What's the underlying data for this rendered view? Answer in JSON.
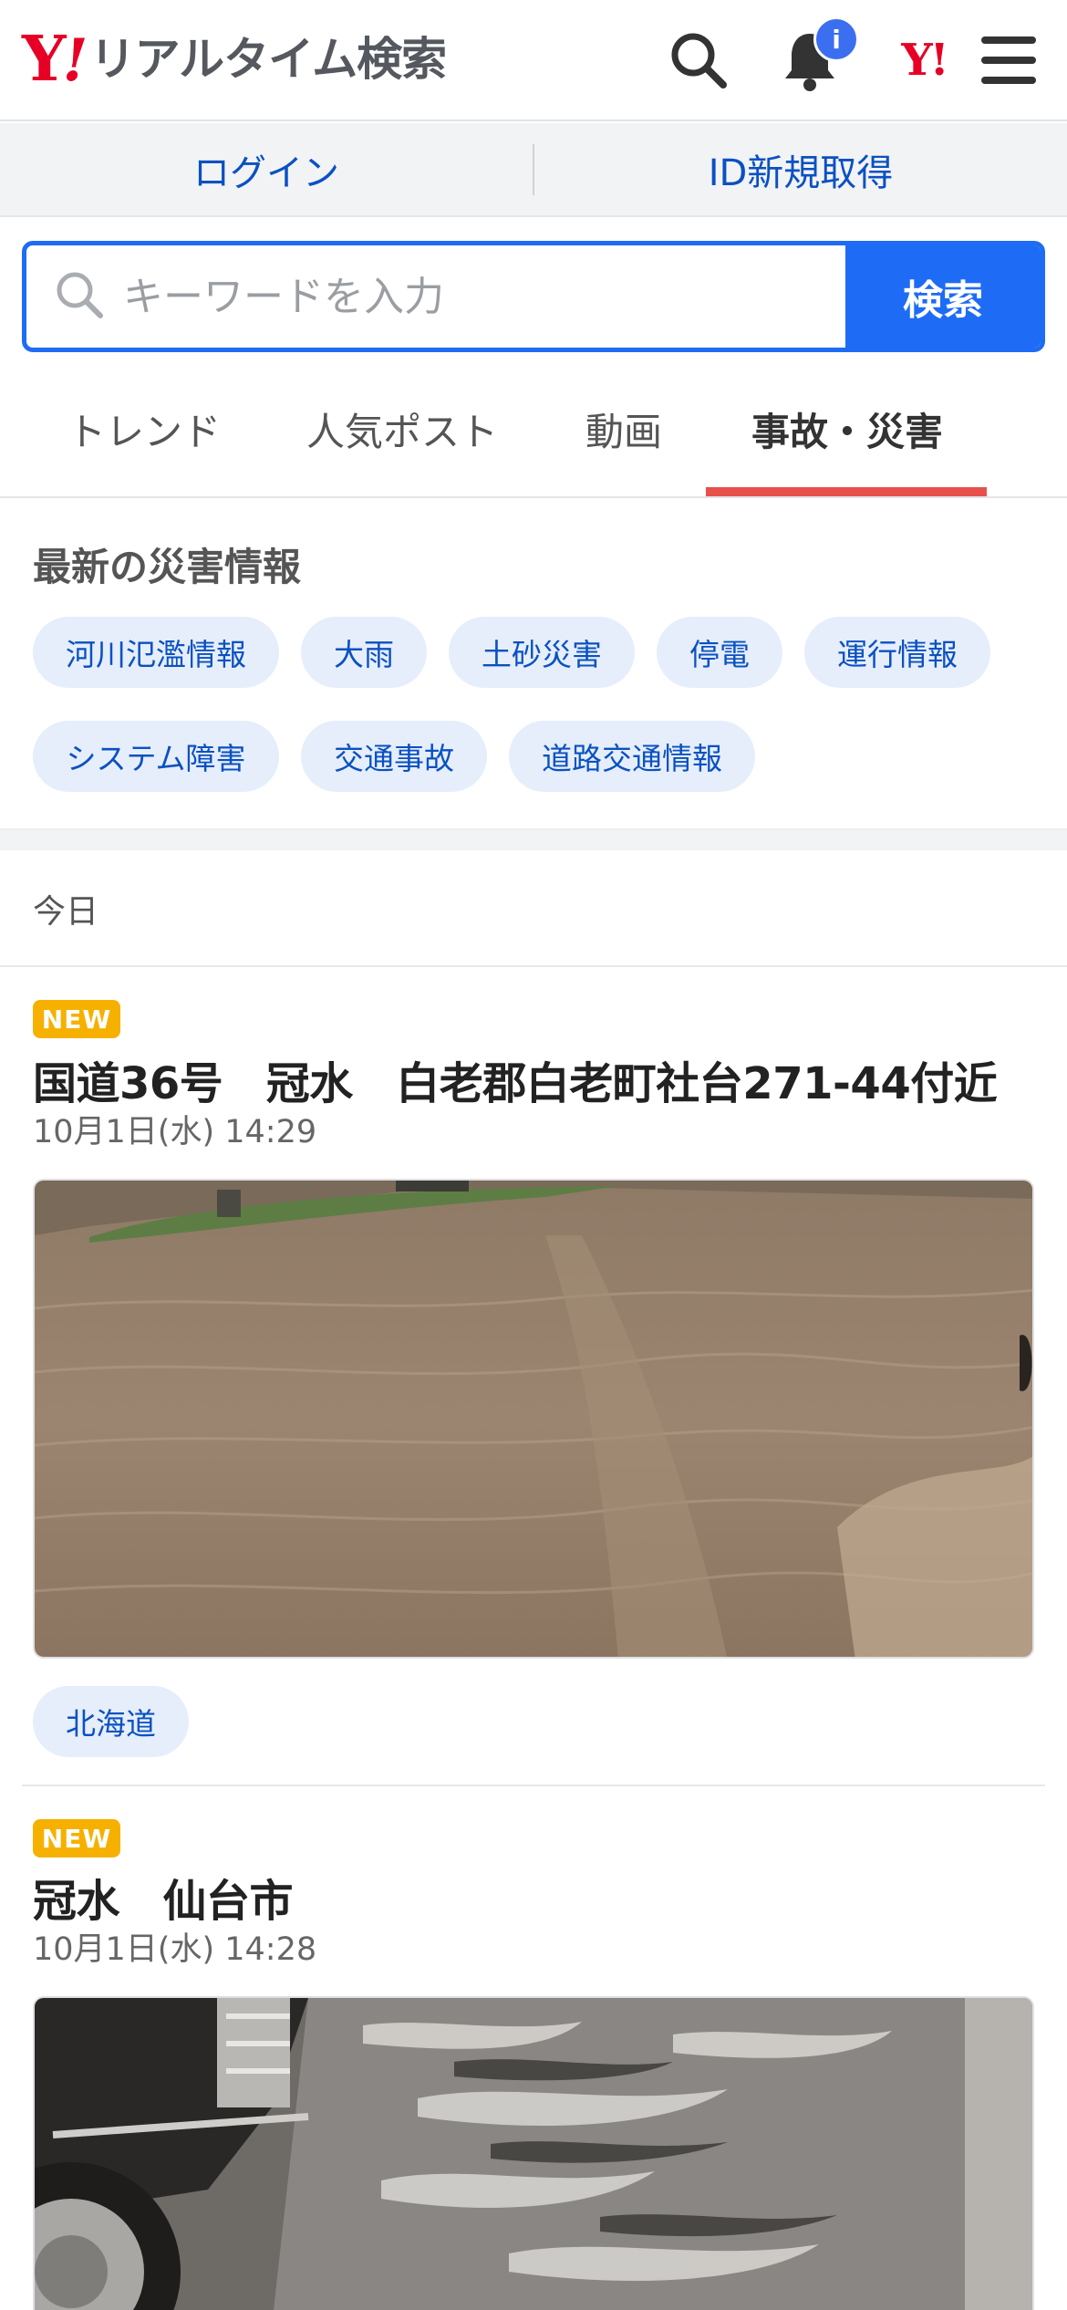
{
  "header": {
    "logo_mark": "Y!",
    "logo_text": "リアルタイム検索",
    "notification_badge": "i",
    "yahoo_link": "Y!"
  },
  "loginbar": {
    "login": "ログイン",
    "signup": "ID新規取得"
  },
  "search": {
    "placeholder": "キーワードを入力",
    "button": "検索"
  },
  "tabs": [
    {
      "label": "トレンド",
      "active": false
    },
    {
      "label": "人気ポスト",
      "active": false
    },
    {
      "label": "動画",
      "active": false
    },
    {
      "label": "事故・災害",
      "active": true
    }
  ],
  "disaster": {
    "title": "最新の災害情報",
    "chips": [
      "河川氾濫情報",
      "大雨",
      "土砂災害",
      "停電",
      "運行情報",
      "システム障害",
      "交通事故",
      "道路交通情報"
    ]
  },
  "feed": {
    "day_label": "今日",
    "posts": [
      {
        "badge": "NEW",
        "title": "国道36号　冠水　白老郡白老町社台271-44付近",
        "time": "10月1日(水) 14:29",
        "location": "北海道"
      },
      {
        "badge": "NEW",
        "title": "冠水　仙台市",
        "time": "10月1日(水) 14:28"
      }
    ]
  },
  "colors": {
    "brand_red": "#e60026",
    "link_blue": "#0a51c2",
    "search_blue": "#1e6cf5",
    "tab_active": "#e8514b",
    "new_badge": "#f6b100"
  }
}
